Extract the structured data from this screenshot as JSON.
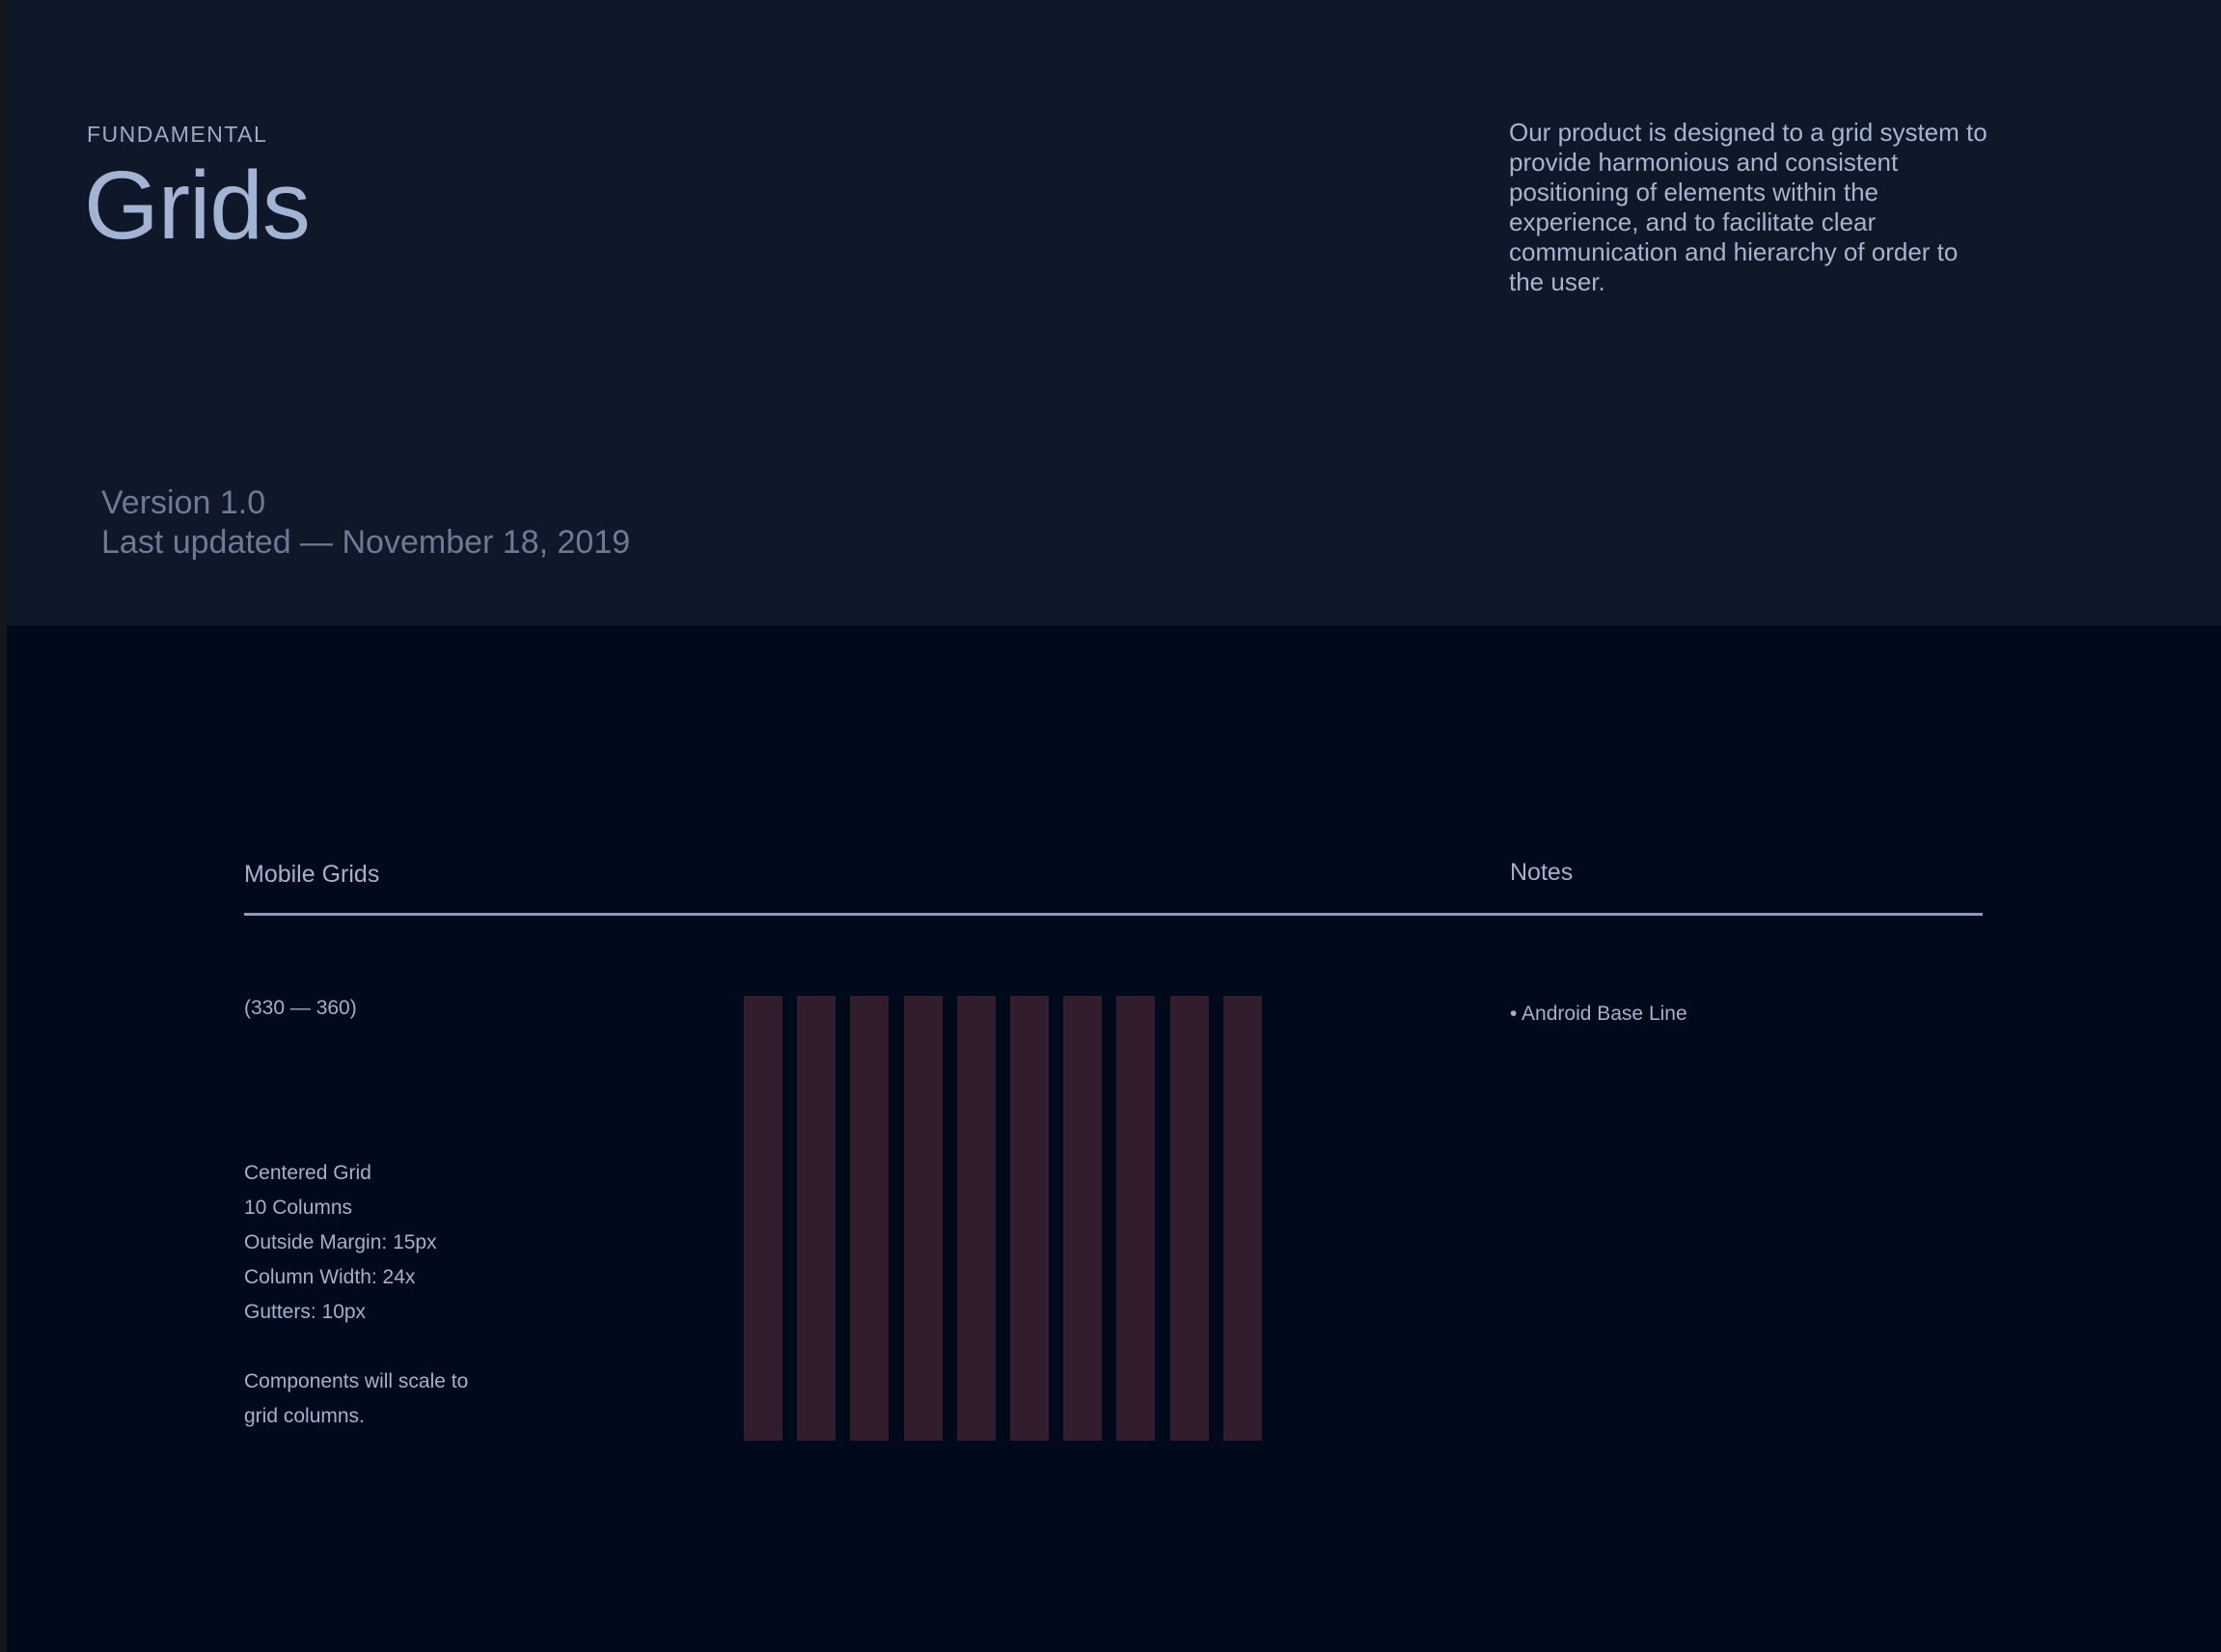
{
  "header": {
    "eyebrow": "FUNDAMENTAL",
    "title": "Grids",
    "intro": "Our product is designed to a grid system to provide harmonious and consistent positioning of elements within the experience, and to facilitate clear communication and hierarchy of order to the user.",
    "version": "Version 1.0",
    "last_updated": "Last updated — November 18, 2019"
  },
  "section": {
    "title": "Mobile Grids",
    "notes_title": "Notes",
    "range": "(330 — 360)",
    "specs": [
      "Centered Grid",
      "10 Columns",
      "Outside Margin: 15px",
      "Column Width: 24x",
      "Gutters: 10px"
    ],
    "scale_note_line1": "Components will scale to",
    "scale_note_line2": "grid columns.",
    "notes": [
      "• Android Base Line"
    ]
  },
  "grid_preview": {
    "columns": 10,
    "column_color": "#321d2f"
  },
  "colors": {
    "header_bg": "#0f1828",
    "body_bg": "#000a1b",
    "text": "#a4b0cc",
    "divider": "#8e97bd"
  }
}
